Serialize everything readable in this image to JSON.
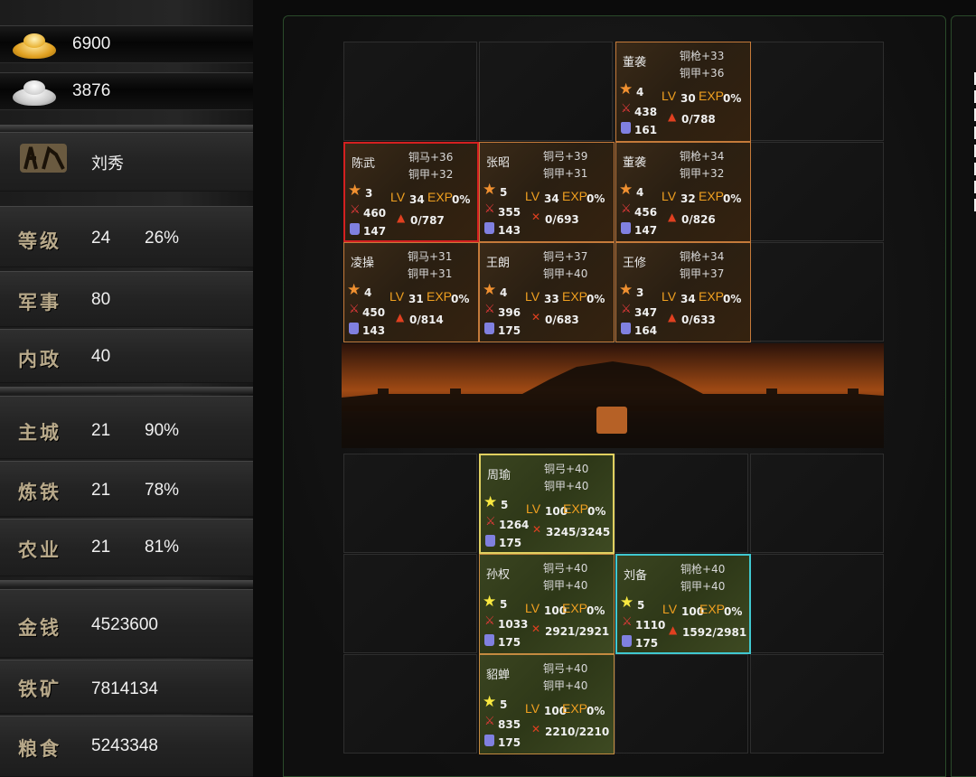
{
  "resources": {
    "gold": "6900",
    "silver": "3876"
  },
  "lord": {
    "name": "刘秀"
  },
  "stats": {
    "level": {
      "label": "等级",
      "value": "24",
      "pct": "26%"
    },
    "military": {
      "label": "军事",
      "value": "80"
    },
    "politics": {
      "label": "内政",
      "value": "40"
    },
    "castle": {
      "label": "主城",
      "value": "21",
      "pct": "90%"
    },
    "smithing": {
      "label": "炼铁",
      "value": "21",
      "pct": "78%"
    },
    "farming": {
      "label": "农业",
      "value": "21",
      "pct": "81%"
    },
    "money": {
      "label": "金钱",
      "value": "4523600"
    },
    "iron": {
      "label": "铁矿",
      "value": "7814134"
    },
    "food": {
      "label": "粮食",
      "value": "5243348"
    }
  },
  "enemy_cards": [
    {
      "name": "董袭",
      "eq1": "铜枪+33",
      "eq2": "铜甲+36",
      "stars": "4",
      "lv": "30",
      "exp": "0%",
      "atk": "438",
      "def": "161",
      "troops": "0/788"
    },
    {
      "name": "陈武",
      "eq1": "铜马+36",
      "eq2": "铜甲+32",
      "stars": "3",
      "lv": "34",
      "exp": "0%",
      "atk": "460",
      "def": "147",
      "troops": "0/787"
    },
    {
      "name": "张昭",
      "eq1": "铜弓+39",
      "eq2": "铜甲+31",
      "stars": "5",
      "lv": "34",
      "exp": "0%",
      "atk": "355",
      "def": "143",
      "troops": "0/693"
    },
    {
      "name": "董袭",
      "eq1": "铜枪+34",
      "eq2": "铜甲+32",
      "stars": "4",
      "lv": "32",
      "exp": "0%",
      "atk": "456",
      "def": "147",
      "troops": "0/826"
    },
    {
      "name": "凌操",
      "eq1": "铜马+31",
      "eq2": "铜甲+31",
      "stars": "4",
      "lv": "31",
      "exp": "0%",
      "atk": "450",
      "def": "143",
      "troops": "0/814"
    },
    {
      "name": "王朗",
      "eq1": "铜弓+37",
      "eq2": "铜甲+40",
      "stars": "4",
      "lv": "33",
      "exp": "0%",
      "atk": "396",
      "def": "175",
      "troops": "0/683"
    },
    {
      "name": "王修",
      "eq1": "铜枪+34",
      "eq2": "铜甲+37",
      "stars": "3",
      "lv": "34",
      "exp": "0%",
      "atk": "347",
      "def": "164",
      "troops": "0/633"
    }
  ],
  "ally_cards": [
    {
      "name": "周瑜",
      "eq1": "铜弓+40",
      "eq2": "铜甲+40",
      "stars": "5",
      "lv": "100",
      "exp": "0%",
      "atk": "1264",
      "def": "175",
      "troops": "3245/3245"
    },
    {
      "name": "孙权",
      "eq1": "铜弓+40",
      "eq2": "铜甲+40",
      "stars": "5",
      "lv": "100",
      "exp": "0%",
      "atk": "1033",
      "def": "175",
      "troops": "2921/2921"
    },
    {
      "name": "刘备",
      "eq1": "铜枪+40",
      "eq2": "铜甲+40",
      "stars": "5",
      "lv": "100",
      "exp": "0%",
      "atk": "1110",
      "def": "175",
      "troops": "1592/2981"
    },
    {
      "name": "貂蝉",
      "eq1": "铜弓+40",
      "eq2": "铜甲+40",
      "stars": "5",
      "lv": "100",
      "exp": "0%",
      "atk": "835",
      "def": "175",
      "troops": "2210/2210"
    }
  ],
  "labels": {
    "lv": "LV",
    "exp": "EXP"
  }
}
